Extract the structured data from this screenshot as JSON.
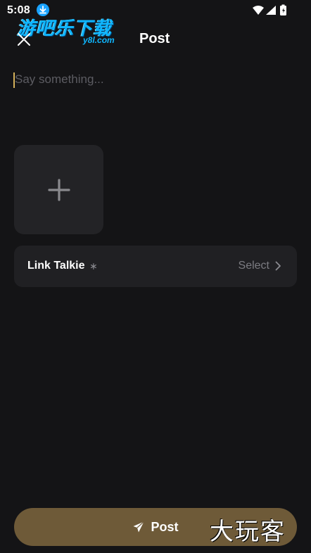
{
  "status_bar": {
    "time": "5:08",
    "icons": [
      "download-icon",
      "wifi-icon",
      "signal-icon",
      "battery-icon"
    ]
  },
  "watermark": {
    "main": "游吧乐下载",
    "sub": "y8l.com",
    "bottom": "大玩客"
  },
  "header": {
    "title": "Post",
    "close_icon": "close-icon"
  },
  "composer": {
    "value": "",
    "placeholder": "Say something..."
  },
  "media": {
    "add_icon": "plus-icon"
  },
  "link_talkie": {
    "label": "Link Talkie",
    "required_mark": "∗",
    "action": "Select",
    "chevron_icon": "chevron-right-icon"
  },
  "footer": {
    "post_label": "Post",
    "post_icon": "send-icon"
  },
  "colors": {
    "background": "#141416",
    "surface": "#202023",
    "accent_button": "#6e5a38",
    "caret": "#d4b15a"
  }
}
